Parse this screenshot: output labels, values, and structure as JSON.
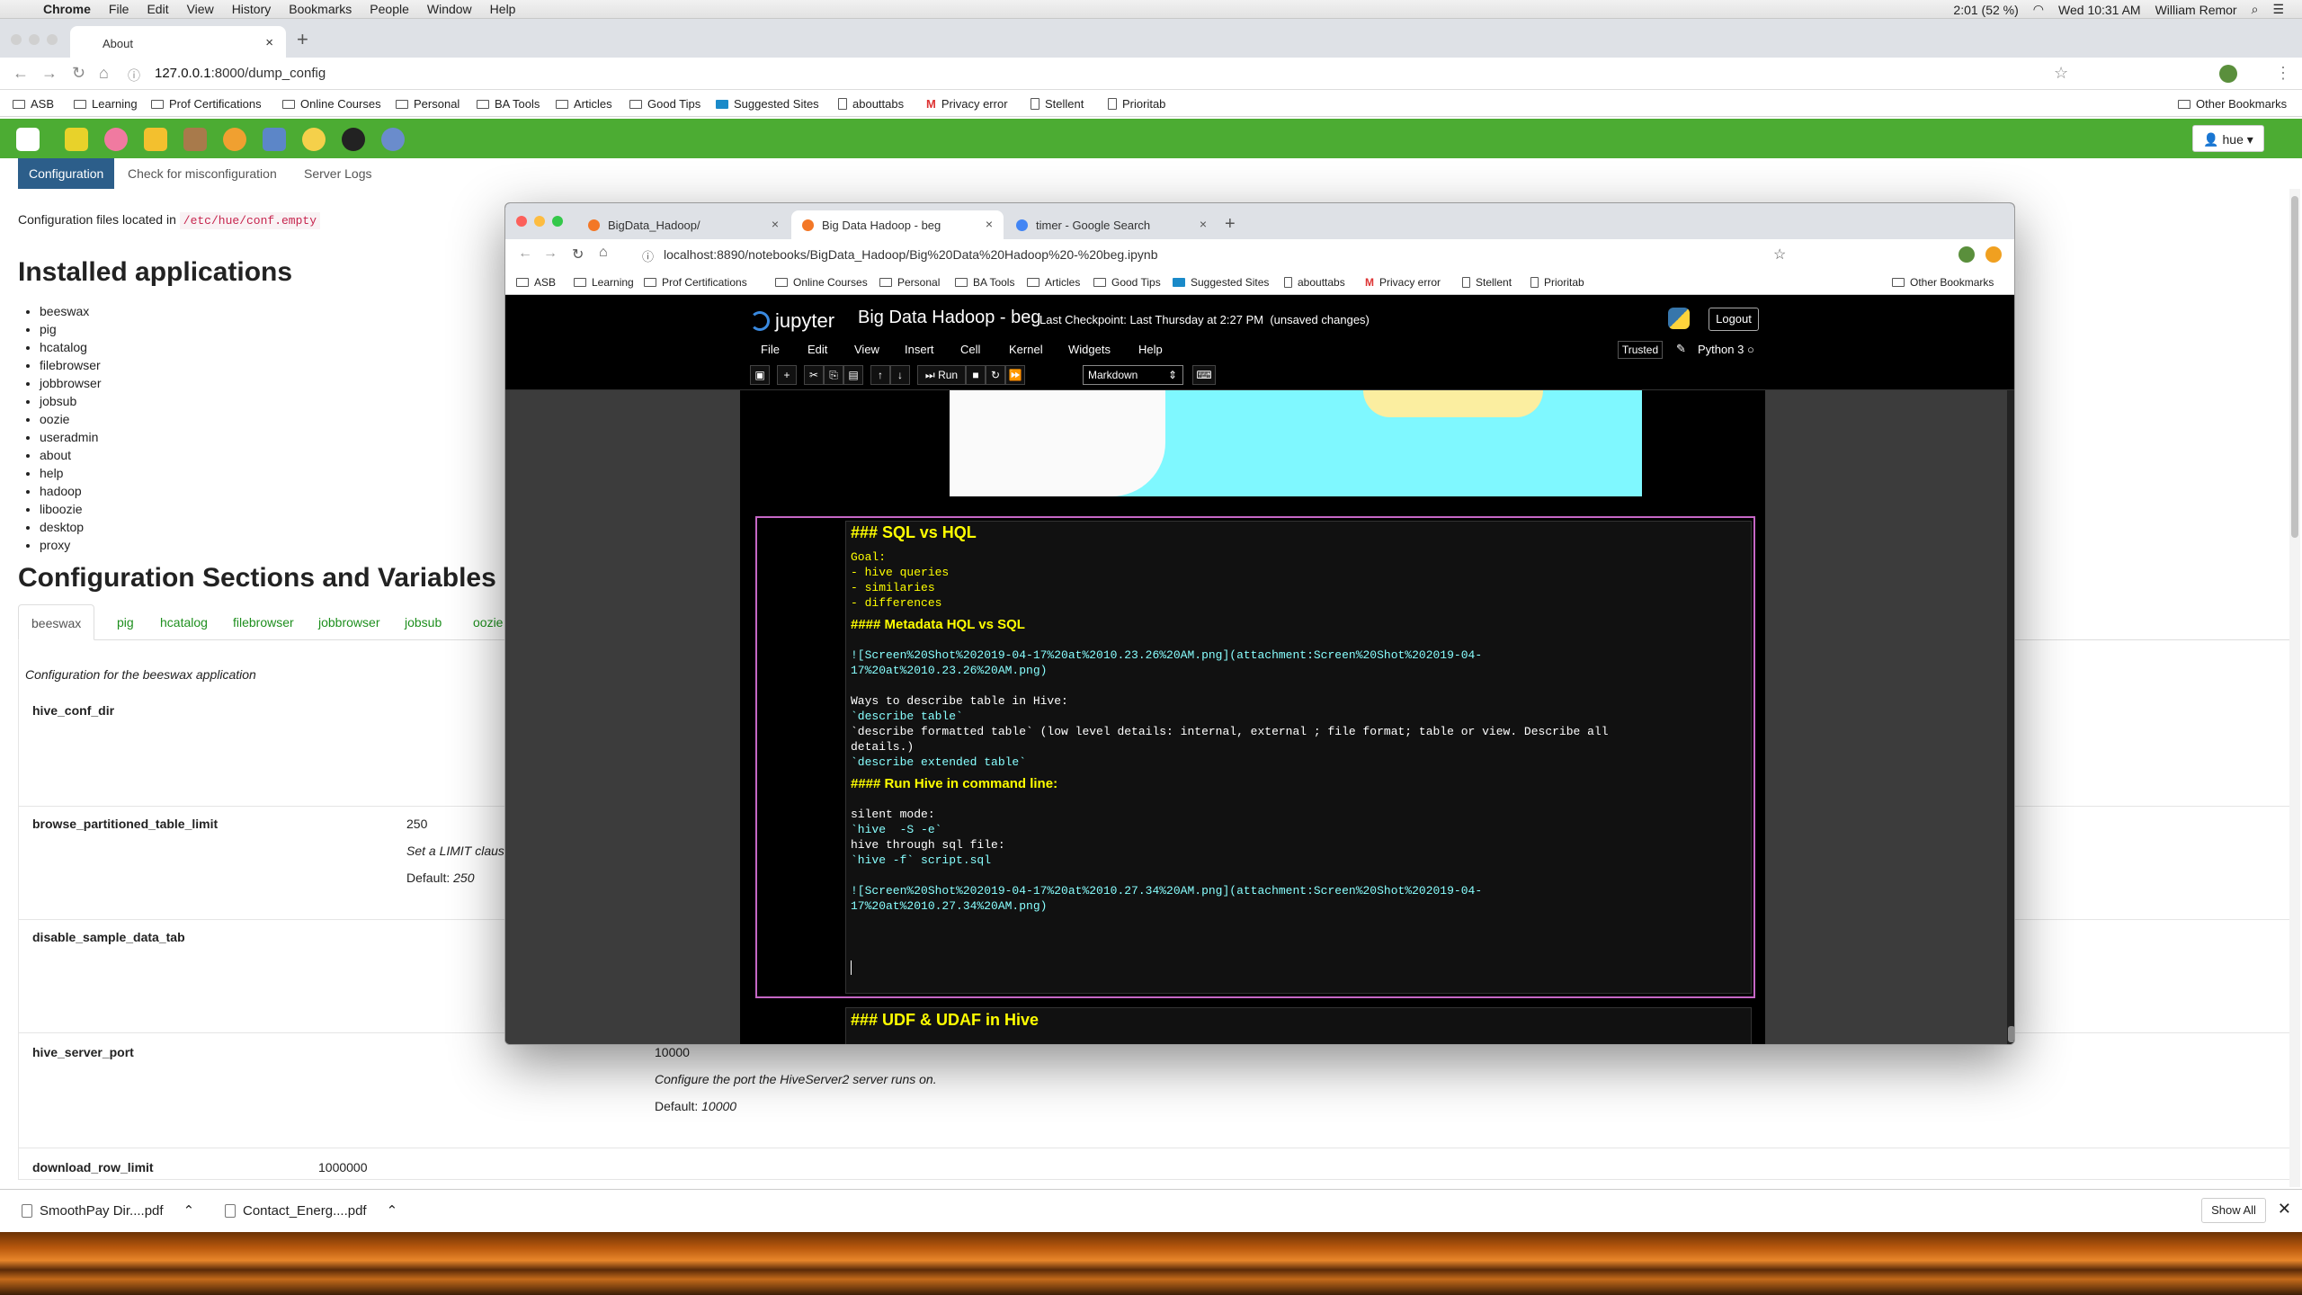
{
  "macmenu": {
    "app": "Chrome",
    "items": [
      "File",
      "Edit",
      "View",
      "History",
      "Bookmarks",
      "People",
      "Window",
      "Help"
    ],
    "battery": "2:01 (52 %)",
    "datetime": "Wed 10:31 AM",
    "user": "William Remor"
  },
  "outer": {
    "tab_title": "About",
    "url_host": "127.0.0.1",
    "url_rest": ":8000/dump_config",
    "bookmarks": [
      "ASB",
      "Learning",
      "Prof Certifications",
      "Online Courses",
      "Personal",
      "BA Tools",
      "Articles",
      "Good Tips",
      "Suggested Sites",
      "abouttabs",
      "Privacy error",
      "Stellent",
      "Prioritab"
    ],
    "other_bookmarks": "Other Bookmarks"
  },
  "hue": {
    "user": "hue",
    "tabs": [
      "Configuration",
      "Check for misconfiguration",
      "Server Logs"
    ],
    "cfg_prefix": "Configuration files located in",
    "cfg_path": "/etc/hue/conf.empty",
    "installed_title": "Installed applications",
    "apps": [
      "beeswax",
      "pig",
      "hcatalog",
      "filebrowser",
      "jobbrowser",
      "jobsub",
      "oozie",
      "useradmin",
      "about",
      "help",
      "hadoop",
      "liboozie",
      "desktop",
      "proxy"
    ],
    "sections_title": "Configuration Sections and Variables",
    "section_tabs": [
      "beeswax",
      "pig",
      "hcatalog",
      "filebrowser",
      "jobbrowser",
      "jobsub",
      "oozie"
    ],
    "panel_intro": "Configuration for the beeswax application",
    "rows": [
      {
        "key": "hive_conf_dir"
      },
      {
        "key": "browse_partitioned_table_limit",
        "value": "250",
        "desc": "Set a LIMIT claus",
        "default_label": "Default:",
        "default": "250"
      },
      {
        "key": "disable_sample_data_tab"
      },
      {
        "key": "hive_server_port",
        "value": "10000",
        "desc": "Configure the port the HiveServer2 server runs on.",
        "default_label": "Default:",
        "default": "10000"
      },
      {
        "key": "download_row_limit",
        "value": "1000000"
      }
    ]
  },
  "downloads": {
    "items": [
      "SmoothPay Dir....pdf",
      "Contact_Energ....pdf"
    ],
    "show_all": "Show All"
  },
  "inner": {
    "tabs": [
      "BigData_Hadoop/",
      "Big Data Hadoop - beg",
      "timer - Google Search"
    ],
    "url": "localhost:8890/notebooks/BigData_Hadoop/Big%20Data%20Hadoop%20-%20beg.ipynb",
    "bookmarks": [
      "ASB",
      "Learning",
      "Prof Certifications",
      "Online Courses",
      "Personal",
      "BA Tools",
      "Articles",
      "Good Tips",
      "Suggested Sites",
      "abouttabs",
      "Privacy error",
      "Stellent",
      "Prioritab"
    ],
    "other_bookmarks": "Other Bookmarks"
  },
  "jupyter": {
    "brand": "jupyter",
    "title": "Big Data Hadoop - beg",
    "checkpoint": "Last Checkpoint: Last Thursday at 2:27 PM",
    "unsaved": "(unsaved changes)",
    "logout": "Logout",
    "menu": [
      "File",
      "Edit",
      "View",
      "Insert",
      "Cell",
      "Kernel",
      "Widgets",
      "Help"
    ],
    "trusted": "Trusted",
    "kernel": "Python 3",
    "run_label": "Run",
    "cell_type": "Markdown",
    "cell_lines": [
      "### SQL vs HQL",
      "Goal:",
      "- hive queries",
      "- similaries",
      "- differences",
      "#### Metadata HQL vs SQL",
      "![Screen%20Shot%202019-04-17%20at%2010.23.26%20AM.png](attachment:Screen%20Shot%202019-04-",
      "17%20at%2010.23.26%20AM.png)",
      "Ways to describe table in Hive:",
      "`describe table`",
      "`describe formatted table` (low level details: internal, external ; file format; table or view. Describe all",
      "details.)",
      "`describe extended table`",
      "#### Run Hive in command line:",
      "silent mode:",
      "`hive  -S -e`",
      "hive through sql file:",
      "`hive -f` script.sql",
      "![Screen%20Shot%202019-04-17%20at%2010.27.34%20AM.png](attachment:Screen%20Shot%202019-04-",
      "17%20at%2010.27.34%20AM.png)"
    ],
    "next_cell": "### UDF & UDAF in Hive"
  }
}
